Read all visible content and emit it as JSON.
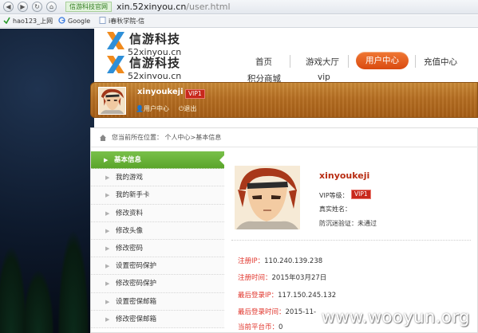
{
  "browser": {
    "site_badge": "信游科技官网",
    "url_host": "xin.52xinyou.cn",
    "url_path": "/user.html",
    "bookmarks": [
      "hao123_上网",
      "Google",
      "i春秋学院-信"
    ]
  },
  "header": {
    "brand": "信游科技",
    "domain": "52xinyou.cn",
    "domain_partial": "52xinyou.cn",
    "nav": [
      "首页",
      "游戏大厅",
      "用户中心",
      "充值中心",
      "积分商城",
      "vip"
    ]
  },
  "banner": {
    "username": "xinyoukeji",
    "dropdown_glyph": "▾",
    "vip": "VIP1",
    "links": [
      "用户中心",
      "退出"
    ]
  },
  "breadcrumb": "您当前所在位置： 个人中心>基本信息",
  "sidebar": [
    "基本信息",
    "我的游戏",
    "我的新手卡",
    "修改资料",
    "修改头像",
    "修改密码",
    "设置密码保护",
    "修改密码保护",
    "设置密保邮箱",
    "修改密保邮箱"
  ],
  "profile": {
    "name": "xinyoukeji",
    "vip_label": "VIP等级：",
    "vip": "VIP1",
    "realname_label": "真实姓名：",
    "addiction_label": "防沉迷验证：未通过"
  },
  "info": [
    {
      "label": "注册IP：",
      "value": "110.240.139.238"
    },
    {
      "label": "注册时间：",
      "value": "2015年03月27日"
    },
    {
      "label": "最后登录IP：",
      "value": "117.150.245.132"
    },
    {
      "label": "最后登录时间：",
      "value": "2015-11-"
    },
    {
      "label": "当前平台币：",
      "value": "0"
    }
  ],
  "watermark": "www.wooyun.org",
  "colors": {
    "nav_active": "#e2561a",
    "side_active": "#6bb33a",
    "banner": "#b56e22",
    "label_red": "#e0332a"
  }
}
